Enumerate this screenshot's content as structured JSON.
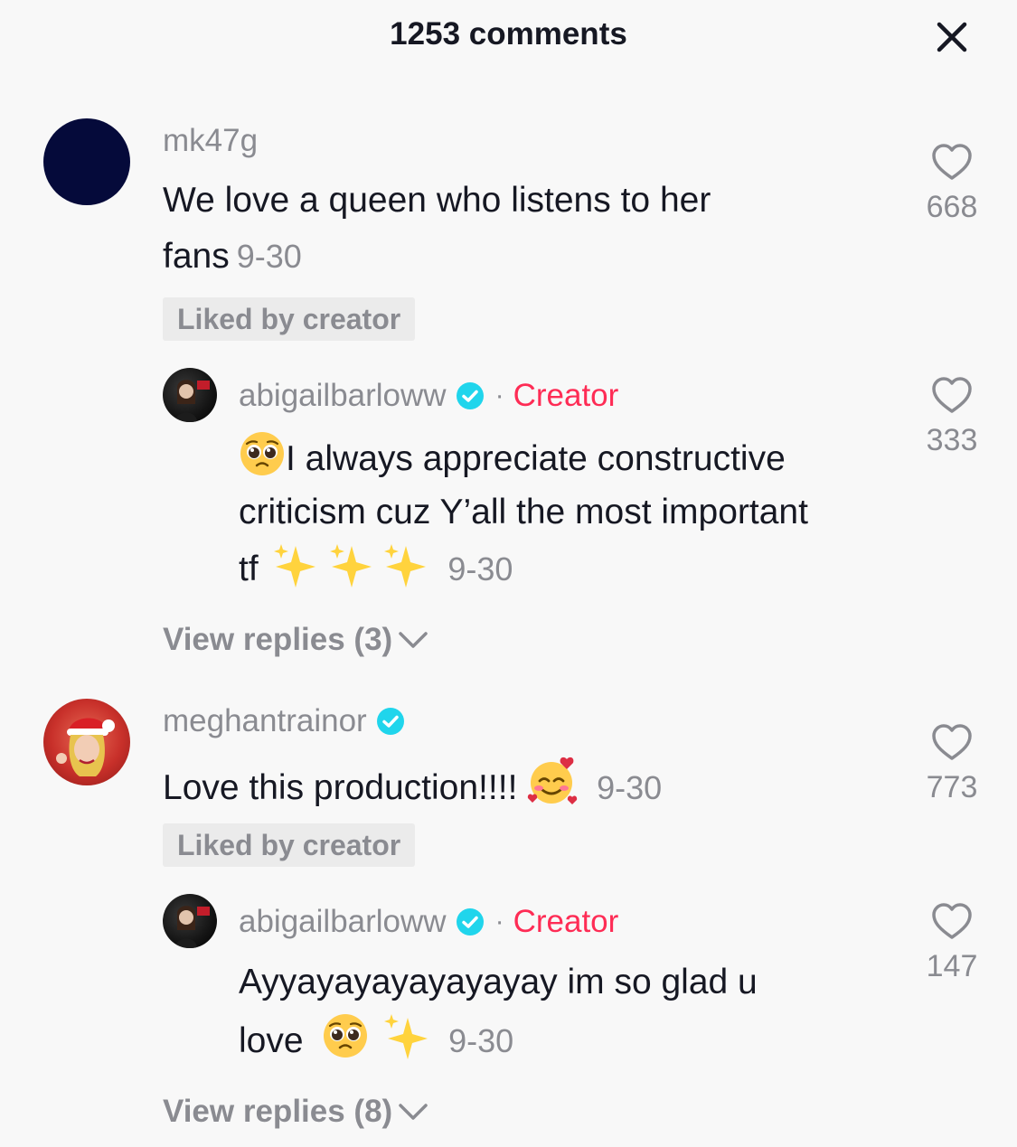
{
  "header": {
    "title": "1253 comments"
  },
  "comments": [
    {
      "username": "mk47g",
      "text": "We love a queen who listens to her",
      "text_line2": "fans",
      "date": "9-30",
      "badge": "Liked by creator",
      "likes": "668",
      "reply": {
        "username": "abigailbarloww",
        "creator_label": "Creator",
        "line1": "I always appreciate constructive",
        "line2": "criticism cuz Y’all the most important",
        "line3": "tf",
        "date": "9-30",
        "likes": "333"
      },
      "view_replies": "View replies (3)"
    },
    {
      "username": "meghantrainor",
      "text": "Love this production!!!!",
      "date": "9-30",
      "badge": "Liked by creator",
      "likes": "773",
      "reply": {
        "username": "abigailbarloww",
        "creator_label": "Creator",
        "line1": "Ayyayayayayayayay im so glad u",
        "line2": "love",
        "date": "9-30",
        "likes": "147"
      },
      "view_replies": "View replies (8)"
    }
  ],
  "colors": {
    "accent": "#fe2c55",
    "verified": "#20d5ec",
    "muted": "#8a8b91",
    "text": "#161823"
  }
}
